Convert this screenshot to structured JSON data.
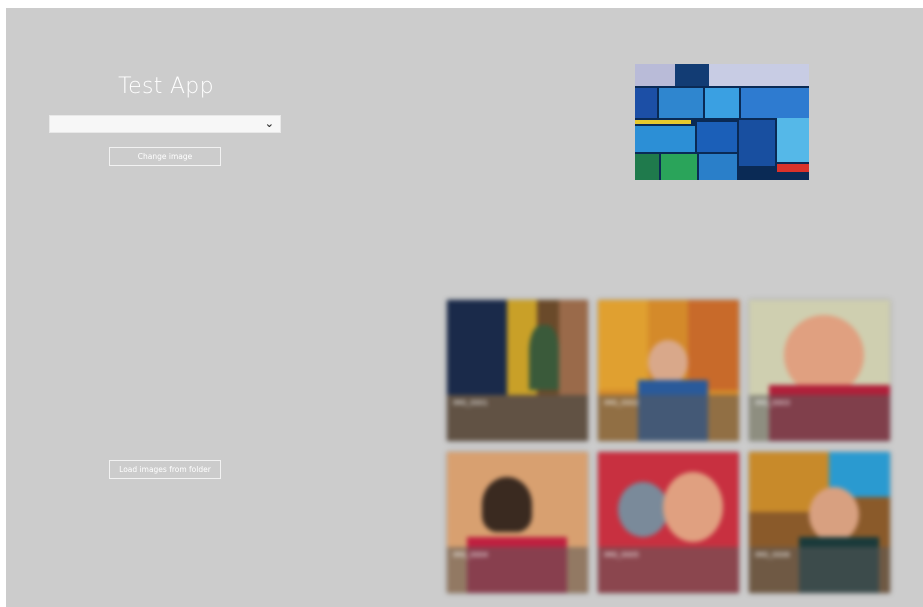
{
  "app": {
    "title": "Test App"
  },
  "image_select": {
    "value": ""
  },
  "buttons": {
    "change_image": "Change image",
    "load_images": "Load images from folder"
  },
  "thumbnails": [
    {
      "caption": "IMG_0001"
    },
    {
      "caption": "IMG_0002"
    },
    {
      "caption": "IMG_0003"
    },
    {
      "caption": "IMG_0004"
    },
    {
      "caption": "IMG_0005"
    },
    {
      "caption": "IMG_0006"
    }
  ],
  "colors": {
    "background": "#cccccc",
    "text": "#ffffff"
  }
}
